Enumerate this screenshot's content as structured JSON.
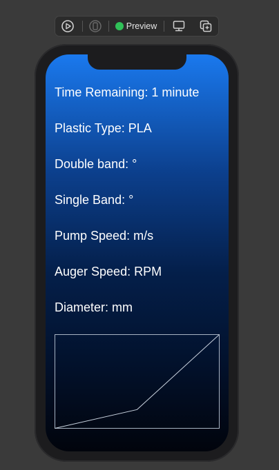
{
  "toolbar": {
    "preview_label": "Preview",
    "icons": [
      "play-circle-icon",
      "device-variant-icon",
      "live-dot-icon",
      "device-settings-icon",
      "duplicate-icon"
    ]
  },
  "screen": {
    "lines": [
      "Time Remaining: 1 minute",
      "Plastic Type: PLA",
      "Double band: °",
      "Single Band: °",
      "Pump Speed:  m/s",
      "Auger Speed:  RPM",
      "Diameter:  mm"
    ],
    "graph": {
      "points": [
        [
          0,
          0
        ],
        [
          0.5,
          0.2
        ],
        [
          1,
          1
        ]
      ]
    }
  },
  "colors": {
    "gradient_top": "#1a79ee",
    "gradient_bottom": "#01040c",
    "live_dot": "#30c158"
  }
}
